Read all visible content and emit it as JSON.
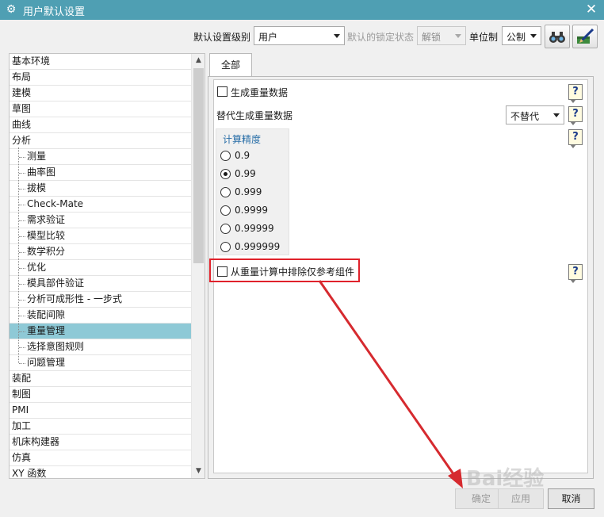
{
  "window": {
    "title": "用户默认设置",
    "close_glyph": "✕"
  },
  "toolbar": {
    "level_label": "默认设置级别",
    "level_value": "用户",
    "lock_label": "默认的锁定状态",
    "lock_value": "解锁",
    "unit_label": "单位制",
    "unit_value": "公制",
    "icons": [
      "binoculars-icon",
      "edit-defaults-icon"
    ]
  },
  "tree": {
    "items": [
      {
        "label": "基本环境",
        "level": 0
      },
      {
        "label": "布局",
        "level": 0
      },
      {
        "label": "建模",
        "level": 0
      },
      {
        "label": "草图",
        "level": 0
      },
      {
        "label": "曲线",
        "level": 0
      },
      {
        "label": "分析",
        "level": 0
      },
      {
        "label": "测量",
        "level": 1
      },
      {
        "label": "曲率图",
        "level": 1
      },
      {
        "label": "拔模",
        "level": 1
      },
      {
        "label": "Check-Mate",
        "level": 1
      },
      {
        "label": "需求验证",
        "level": 1
      },
      {
        "label": "模型比较",
        "level": 1
      },
      {
        "label": "数学积分",
        "level": 1
      },
      {
        "label": "优化",
        "level": 1
      },
      {
        "label": "模具部件验证",
        "level": 1
      },
      {
        "label": "分析可成形性 - 一步式",
        "level": 1
      },
      {
        "label": "装配间隙",
        "level": 1
      },
      {
        "label": "重量管理",
        "level": 1,
        "selected": true
      },
      {
        "label": "选择意图规则",
        "level": 1
      },
      {
        "label": "问题管理",
        "level": 1
      },
      {
        "label": "装配",
        "level": 0
      },
      {
        "label": "制图",
        "level": 0
      },
      {
        "label": "PMI",
        "level": 0
      },
      {
        "label": "加工",
        "level": 0
      },
      {
        "label": "机床构建器",
        "level": 0
      },
      {
        "label": "仿真",
        "level": 0
      },
      {
        "label": "XY 函数",
        "level": 0
      }
    ]
  },
  "tabs": [
    {
      "label": "全部",
      "active": true
    }
  ],
  "settings": {
    "generate_weight_label": "生成重量数据",
    "generate_weight_checked": false,
    "alt_generate_label": "替代生成重量数据",
    "alt_generate_value": "不替代",
    "precision_group_title": "计算精度",
    "precision_options": [
      "0.9",
      "0.99",
      "0.999",
      "0.9999",
      "0.99999",
      "0.999999"
    ],
    "precision_selected": "0.99",
    "exclude_ref_label": "从重量计算中排除仅参考组件",
    "exclude_ref_checked": false,
    "help_glyph": "?"
  },
  "footer": {
    "ok_label": "确定",
    "apply_label": "应用",
    "cancel_label": "取消"
  },
  "watermark": "Bai经验",
  "colors": {
    "titlebar": "#4f9fb3",
    "selected_row": "#8ec9d6",
    "highlight_box": "#e0222b",
    "arrow": "#d62a2f"
  }
}
